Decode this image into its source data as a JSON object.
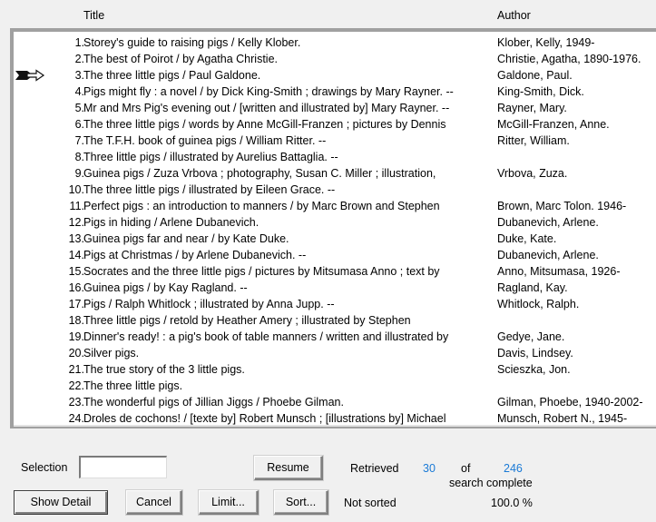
{
  "header": {
    "title_col": "Title",
    "author_col": "Author"
  },
  "list": {
    "current_row_index": 2,
    "marker_icon": "pointing-arrow-icon",
    "rows": [
      {
        "num": "1.",
        "title": "Storey's guide to raising pigs / Kelly Klober.",
        "author": "Klober, Kelly, 1949-"
      },
      {
        "num": "2.",
        "title": "The best of Poirot / by Agatha Christie.",
        "author": "Christie, Agatha, 1890-1976."
      },
      {
        "num": "3.",
        "title": "The three little pigs / Paul Galdone.",
        "author": "Galdone, Paul."
      },
      {
        "num": "4.",
        "title": "Pigs might fly : a novel / by Dick King-Smith ; drawings by Mary Rayner. --",
        "author": "King-Smith, Dick."
      },
      {
        "num": "5.",
        "title": "Mr and Mrs Pig's evening out / [written and illustrated by] Mary Rayner. --",
        "author": "Rayner, Mary."
      },
      {
        "num": "6.",
        "title": "The three little pigs / words by Anne McGill-Franzen ; pictures by Dennis",
        "author": "McGill-Franzen, Anne."
      },
      {
        "num": "7.",
        "title": "The T.F.H. book of guinea pigs / William Ritter. --",
        "author": "Ritter, William."
      },
      {
        "num": "8.",
        "title": "Three little pigs / illustrated by Aurelius Battaglia. --",
        "author": ""
      },
      {
        "num": "9.",
        "title": "Guinea pigs / Zuza Vrbova ; photography, Susan C. Miller ; illustration,",
        "author": "Vrbova, Zuza."
      },
      {
        "num": "10.",
        "title": "The three little pigs / illustrated by Eileen Grace. --",
        "author": ""
      },
      {
        "num": "11.",
        "title": "Perfect pigs : an introduction to manners / by Marc Brown and Stephen",
        "author": "Brown, Marc Tolon. 1946-"
      },
      {
        "num": "12.",
        "title": "Pigs in hiding / Arlene Dubanevich.",
        "author": "Dubanevich, Arlene."
      },
      {
        "num": "13.",
        "title": "Guinea pigs far and near / by Kate Duke.",
        "author": "Duke, Kate."
      },
      {
        "num": "14.",
        "title": "Pigs at Christmas / by Arlene Dubanevich. --",
        "author": "Dubanevich, Arlene."
      },
      {
        "num": "15.",
        "title": "Socrates and the three little pigs / pictures by Mitsumasa Anno ; text by",
        "author": "Anno, Mitsumasa, 1926-"
      },
      {
        "num": "16.",
        "title": "Guinea pigs / by Kay Ragland. --",
        "author": "Ragland, Kay."
      },
      {
        "num": "17.",
        "title": "Pigs / Ralph Whitlock ; illustrated by Anna Jupp. --",
        "author": "Whitlock, Ralph."
      },
      {
        "num": "18.",
        "title": "Three little pigs / retold by Heather Amery ; illustrated by Stephen",
        "author": ""
      },
      {
        "num": "19.",
        "title": "Dinner's ready! : a pig's book of table manners / written and illustrated by",
        "author": "Gedye, Jane."
      },
      {
        "num": "20.",
        "title": "Silver pigs.",
        "author": "Davis, Lindsey."
      },
      {
        "num": "21.",
        "title": "The true story of the 3 little pigs.",
        "author": "Scieszka, Jon."
      },
      {
        "num": "22.",
        "title": "The three little pigs.",
        "author": ""
      },
      {
        "num": "23.",
        "title": "The wonderful pigs of Jillian Jiggs / Phoebe Gilman.",
        "author": "Gilman, Phoebe, 1940-2002-"
      },
      {
        "num": "24.",
        "title": "Droles de cochons! / [texte by] Robert Munsch ; [illustrations by] Michael",
        "author": "Munsch, Robert N., 1945-"
      }
    ]
  },
  "controls": {
    "selection_label": "Selection",
    "selection_value": "",
    "resume_label": "Resume",
    "show_detail_label": "Show Detail",
    "cancel_label": "Cancel",
    "limit_label": "Limit...",
    "sort_label": "Sort..."
  },
  "status": {
    "retrieved_label": "Retrieved",
    "retrieved_count": "30",
    "of_label": "of",
    "total_count": "246",
    "search_status": "search complete",
    "sort_status": "Not sorted",
    "percent_complete": "100.0 %",
    "count_color": "#1a7ad6"
  }
}
